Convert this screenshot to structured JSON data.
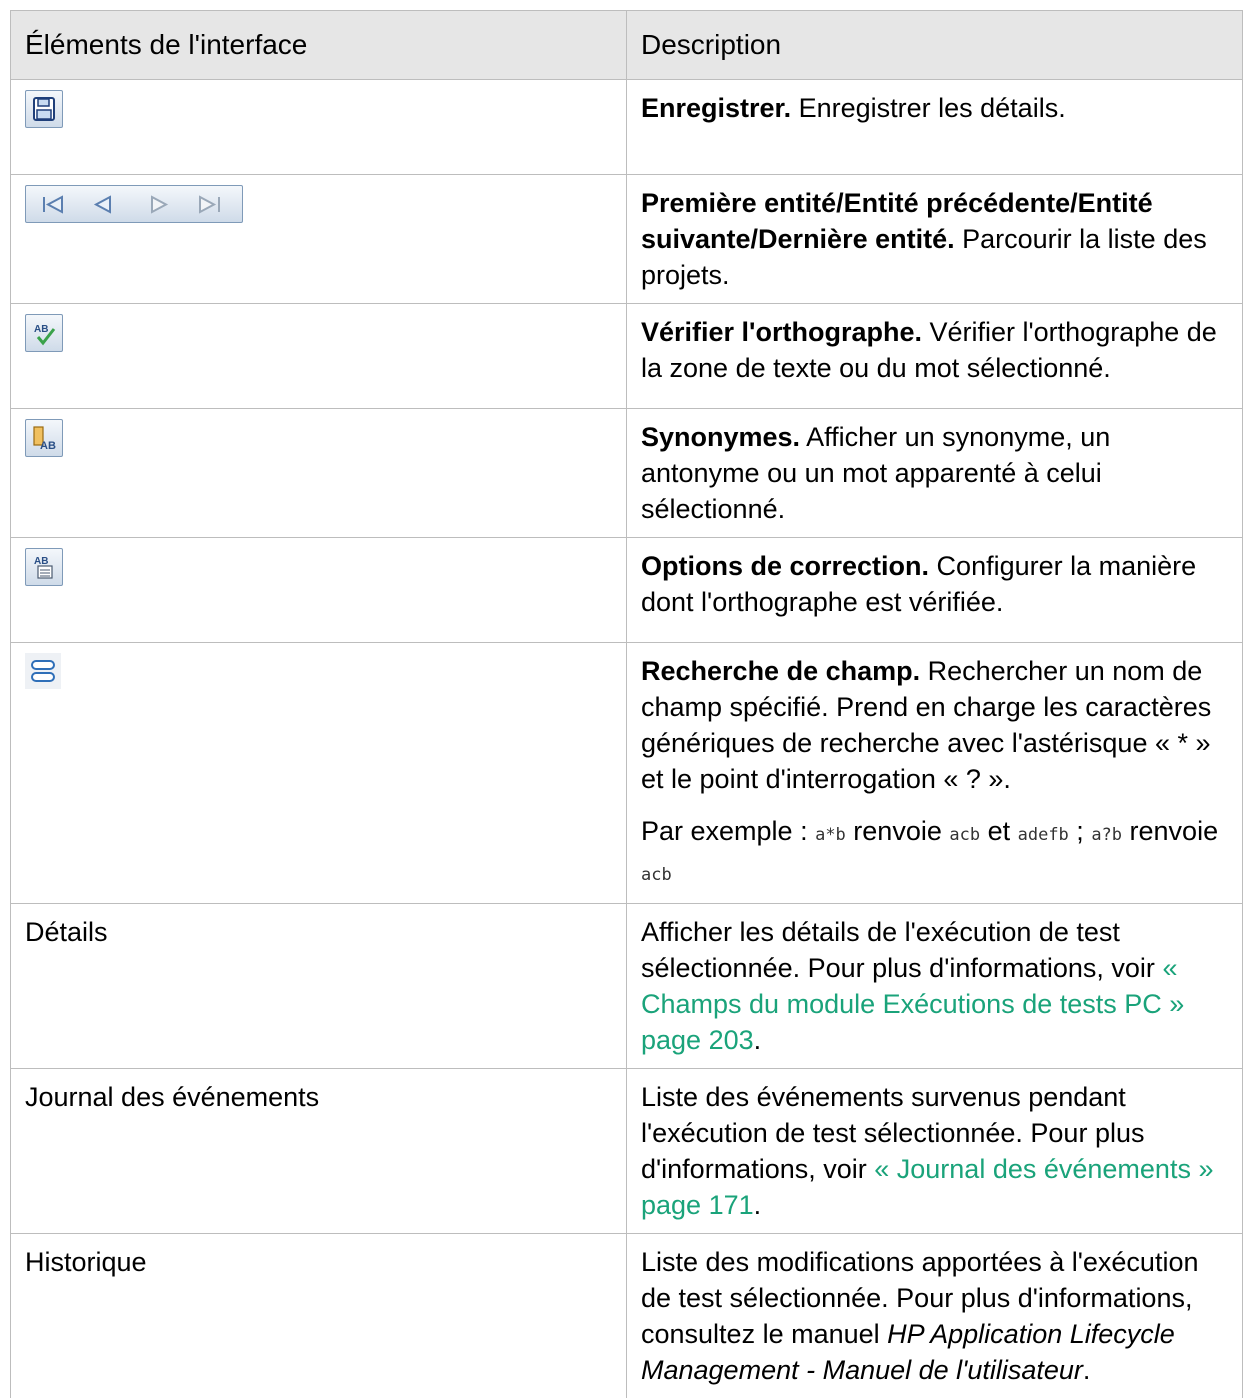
{
  "table": {
    "header": {
      "col1": "Éléments de l'interface",
      "col2": "Description"
    },
    "rows": [
      {
        "icon": "save-icon",
        "title": "Enregistrer.",
        "text": " Enregistrer les détails."
      },
      {
        "icon": "navigation-icons",
        "title": "Première entité/Entité précédente/Entité suivante/Dernière entité.",
        "text": " Parcourir la liste des projets."
      },
      {
        "icon": "spell-check-icon",
        "title": "Vérifier l'orthographe.",
        "text": " Vérifier l'orthographe de la zone de texte ou du mot sélectionné."
      },
      {
        "icon": "thesaurus-icon",
        "title": "Synonymes.",
        "text": " Afficher un synonyme, un antonyme ou un mot apparenté à celui sélectionné."
      },
      {
        "icon": "spelling-options-icon",
        "title": "Options de correction.",
        "text": " Configurer la manière dont l'orthographe est vérifiée."
      },
      {
        "icon": "field-search-icon",
        "title": "Recherche de champ.",
        "text": " Rechercher un nom de champ spécifié. Prend en charge les caractères génériques de recherche avec l'astérisque « * » et le point d'interrogation « ? ».",
        "example": {
          "prefix": "Par exemple : ",
          "code1": "a*b",
          "mid1": " renvoie ",
          "code2": "acb",
          "mid2": " et ",
          "code3": "adefb",
          "mid3": " ; ",
          "code4": "a?b",
          "mid4": " renvoie ",
          "code5": "acb"
        }
      },
      {
        "label": "Détails",
        "text": "Afficher les détails de l'exécution de test sélectionnée. Pour plus d'informations, voir ",
        "link": "« Champs du module Exécutions de tests PC » page 203",
        "end": "."
      },
      {
        "label": "Journal des événements",
        "text": "Liste des événements survenus pendant l'exécution de test sélectionnée. Pour plus d'informations, voir ",
        "link": "« Journal des événements » page 171",
        "end": "."
      },
      {
        "label": "Historique",
        "text": "Liste des modifications apportées à l'exécution de test sélectionnée. Pour plus d'informations, consultez le manuel ",
        "italic": "HP Application Lifecycle Management - Manuel de l'utilisateur",
        "end": "."
      }
    ]
  },
  "colors": {
    "link": "#1aa37a",
    "header_bg": "#e6e6e6",
    "border": "#bdbdbd"
  }
}
